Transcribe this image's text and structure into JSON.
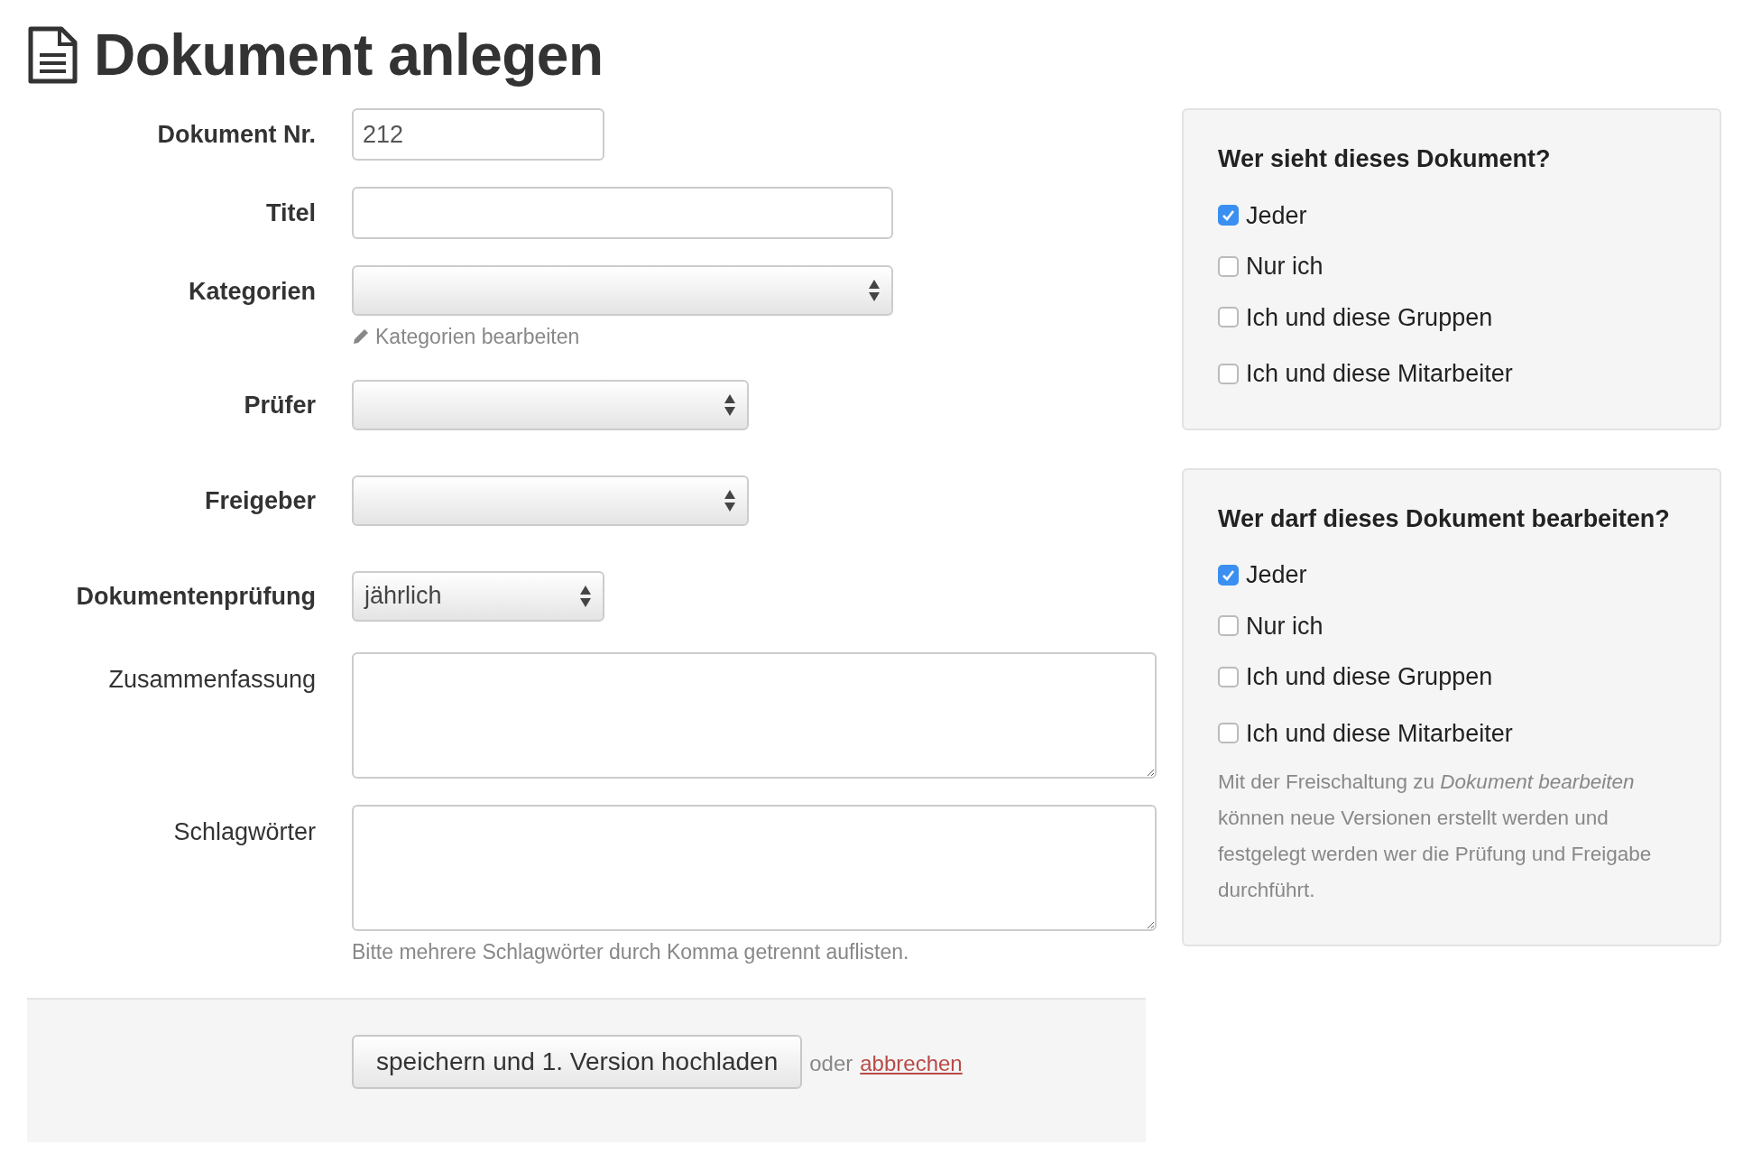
{
  "title": "Dokument anlegen",
  "fields": [
    {
      "kind": "input",
      "label": "Dokument Nr.",
      "required": true,
      "value": "212"
    },
    {
      "kind": "input",
      "label": "Titel",
      "required": true
    },
    {
      "kind": "select",
      "label": "Kategorien",
      "required": true,
      "help_link": "Kategorien bearbeiten"
    },
    {
      "kind": "select",
      "label": "Prüfer",
      "required": true
    },
    {
      "kind": "select",
      "label": "Freigeber",
      "required": true
    },
    {
      "kind": "select",
      "label": "Dokumentenprüfung",
      "required": true,
      "value": "jährlich"
    },
    {
      "kind": "textarea",
      "label": "Zusammenfassung",
      "required": false
    },
    {
      "kind": "textarea",
      "label": "Schlagwörter",
      "required": false,
      "help": "Bitte mehrere Schlagwörter durch Komma getrennt auflisten."
    }
  ],
  "footer": {
    "submit": "speichern und 1. Version hochladen",
    "or": "oder",
    "cancel": "abbrechen"
  },
  "panels": [
    {
      "heading": "Wer sieht dieses Dokument?",
      "options": [
        {
          "label": "Jeder",
          "checked": true
        },
        {
          "label": "Nur ich",
          "checked": false
        },
        {
          "label": "Ich und diese Gruppen",
          "checked": false
        },
        {
          "label": "Ich und diese Mitarbeiter",
          "checked": false
        }
      ]
    },
    {
      "heading": "Wer darf dieses Dokument bearbeiten?",
      "options": [
        {
          "label": "Jeder",
          "checked": true
        },
        {
          "label": "Nur ich",
          "checked": false
        },
        {
          "label": "Ich und diese Gruppen",
          "checked": false
        },
        {
          "label": "Ich und diese Mitarbeiter",
          "checked": false
        }
      ],
      "note": "Mit der Freischaltung zu *Dokument bearbeiten* können neue Versionen erstellt werden und festgelegt werden wer die Prüfung und Freigabe durchführt."
    }
  ]
}
